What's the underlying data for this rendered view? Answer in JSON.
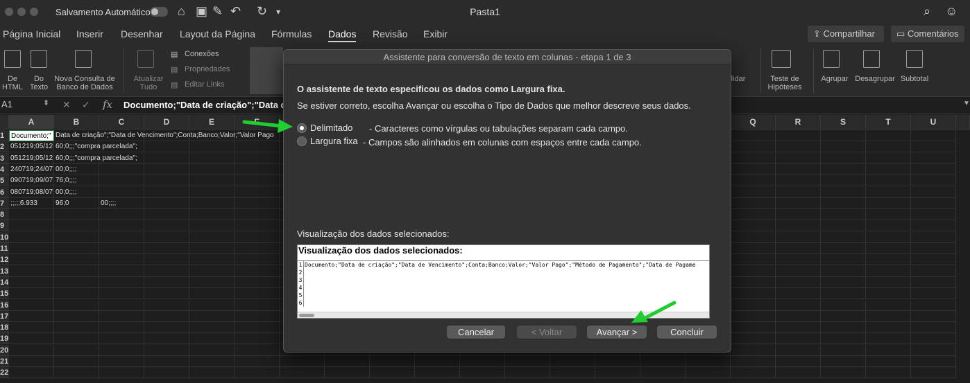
{
  "titlebar": {
    "autosave_label": "Salvamento Automático",
    "doc_title": "Pasta1"
  },
  "tabs": [
    "Página Inicial",
    "Inserir",
    "Desenhar",
    "Layout da Página",
    "Fórmulas",
    "Dados",
    "Revisão",
    "Exibir"
  ],
  "active_tab": "Dados",
  "share_buttons": {
    "share": "Compartilhar",
    "comments": "Comentários"
  },
  "ribbon": {
    "from_html": "De\nHTML",
    "from_text": "Do\nTexto",
    "new_query": "Nova Consulta de\nBanco de Dados",
    "refresh_all": "Atualizar\nTudo",
    "connections": "Conexões",
    "properties": "Propriedades",
    "edit_links": "Editar Links",
    "consolidate": "olidar",
    "what_if": "Teste de\nHipóteses",
    "group": "Agrupar",
    "ungroup": "Desagrupar",
    "subtotal": "Subtotal"
  },
  "formula_bar": {
    "cell_ref": "A1",
    "fx": "fx",
    "content": "Documento;\"Data de criação\";\"Data de"
  },
  "columns": [
    "A",
    "B",
    "C",
    "D",
    "E",
    "F",
    "",
    "",
    "",
    "",
    "",
    "",
    "",
    "",
    "",
    "",
    "Q",
    "R",
    "S",
    "T",
    "U"
  ],
  "rows": [
    "1",
    "2",
    "3",
    "4",
    "5",
    "6",
    "7",
    "8",
    "9",
    "10",
    "11",
    "12",
    "13",
    "14",
    "15",
    "16",
    "17",
    "18",
    "19",
    "20",
    "21",
    "22"
  ],
  "cells": {
    "r1a": "Documento;\"",
    "r1b": "Data de criação\";\"Data de Vencimento\";Conta;Banco;Valor;\"Valor Pago",
    "r2a": "051219;05/12",
    "r2b": "60;0;;;\"compra parcelada\";",
    "r3a": "051219;05/12",
    "r3b": "60;0;;;\"compra parcelada\";",
    "r4a": "240719;24/07",
    "r4b": "00;0;;;;",
    "r5a": "090719;09/07",
    "r5b": "76;0;;;;",
    "r6a": "080719;08/07",
    "r6b": "00;0;;;;",
    "r7a": ";;;;;6.933",
    "r7b": "96;0",
    "r7c": "00;;;;"
  },
  "dialog": {
    "title": "Assistente para conversão de texto em colunas - etapa 1 de 3",
    "intro_bold": "O assistente de texto especificou os dados como Largura fixa.",
    "intro": "Se estiver correto, escolha Avançar ou escolha o Tipo de Dados que melhor descreve seus dados.",
    "option1_label": "Delimitado",
    "option1_desc": "- Caracteres como vírgulas ou tabulações separam cada campo.",
    "option2_label": "Largura fixa",
    "option2_desc": "- Campos são alinhados em colunas com espaços entre cada campo.",
    "preview_label": "Visualização dos dados selecionados:",
    "preview_title": "Visualização dos dados selecionados:",
    "preview_rows": [
      {
        "n": "1",
        "text": "Documento;\"Data de criação\";\"Data de Vencimento\";Conta;Banco;Valor;\"Valor Pago\";\"Método de Pagamento\";\"Data de Pagame"
      },
      {
        "n": "2",
        "text": ""
      },
      {
        "n": "3",
        "text": ""
      },
      {
        "n": "4",
        "text": ""
      },
      {
        "n": "5",
        "text": ""
      },
      {
        "n": "6",
        "text": ""
      }
    ],
    "btn_cancel": "Cancelar",
    "btn_back": "< Voltar",
    "btn_next": "Avançar >",
    "btn_finish": "Concluir"
  },
  "colors": {
    "arrow": "#22cc33"
  }
}
